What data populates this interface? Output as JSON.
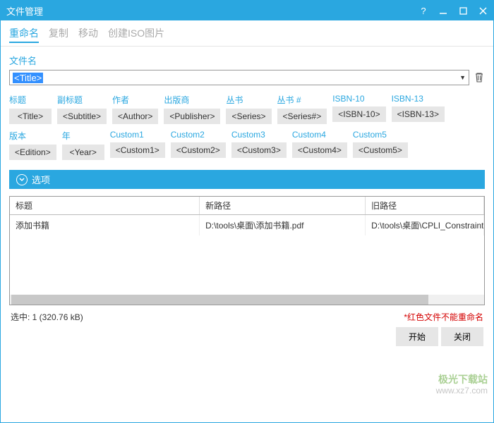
{
  "window": {
    "title": "文件管理"
  },
  "tabs": {
    "rename": "重命名",
    "copy": "复制",
    "move": "移动",
    "iso": "创建ISO图片"
  },
  "filename": {
    "label": "文件名",
    "value": "<Title>"
  },
  "tags": [
    {
      "label": "标题",
      "btn": "<Title>"
    },
    {
      "label": "副标题",
      "btn": "<Subtitle>"
    },
    {
      "label": "作者",
      "btn": "<Author>"
    },
    {
      "label": "出版商",
      "btn": "<Publisher>"
    },
    {
      "label": "丛书",
      "btn": "<Series>"
    },
    {
      "label": "丛书 #",
      "btn": "<Series#>"
    },
    {
      "label": "ISBN-10",
      "btn": "<ISBN-10>"
    },
    {
      "label": "ISBN-13",
      "btn": "<ISBN-13>"
    },
    {
      "label": "版本",
      "btn": "<Edition>"
    },
    {
      "label": "年",
      "btn": "<Year>"
    },
    {
      "label": "Custom1",
      "btn": "<Custom1>"
    },
    {
      "label": "Custom2",
      "btn": "<Custom2>"
    },
    {
      "label": "Custom3",
      "btn": "<Custom3>"
    },
    {
      "label": "Custom4",
      "btn": "<Custom4>"
    },
    {
      "label": "Custom5",
      "btn": "<Custom5>"
    }
  ],
  "options": {
    "label": "选项"
  },
  "table": {
    "headers": {
      "title": "标题",
      "newpath": "新路径",
      "oldpath": "旧路径"
    },
    "rows": [
      {
        "title": "添加书籍",
        "newpath": "D:\\tools\\桌面\\添加书籍.pdf",
        "oldpath": "D:\\tools\\桌面\\CPLI_Constraint"
      }
    ]
  },
  "status": {
    "selected": "选中: 1 (320.76 kB)",
    "error": "*红色文件不能重命名"
  },
  "actions": {
    "start": "开始",
    "close": "关闭"
  },
  "watermark": {
    "line1": "极光下载站",
    "line2": "www.xz7.com"
  }
}
